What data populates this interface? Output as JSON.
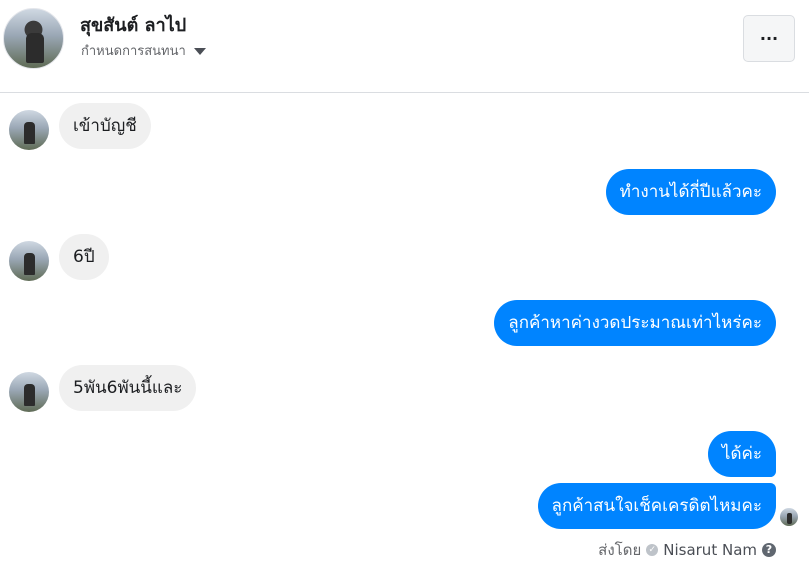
{
  "header": {
    "contact_name": "สุขสันต์ ลาไป",
    "subtitle": "กำหนดการสนทนา",
    "more_label": "···"
  },
  "messages": [
    {
      "from": "them",
      "text": "เข้าบัญชี"
    },
    {
      "from": "me",
      "text": "ทำงานได้กี่ปีแล้วคะ"
    },
    {
      "from": "them",
      "text": "6ปี"
    },
    {
      "from": "me",
      "text": "ลูกค้าหาค่างวดประมาณเท่าไหร่คะ"
    },
    {
      "from": "them",
      "text": "5พัน6พันนี้และ"
    },
    {
      "from": "me",
      "text": "ได้ค่ะ"
    },
    {
      "from": "me",
      "text": "ลูกค้าสนใจเช็คเครดิตไหมคะ"
    }
  ],
  "footer": {
    "sent_by_label": "ส่งโดย",
    "sender_name": "Nisarut Nam",
    "help_icon": "?"
  },
  "colors": {
    "outgoing_bubble": "#0084ff",
    "incoming_bubble": "#f0f0f0"
  }
}
